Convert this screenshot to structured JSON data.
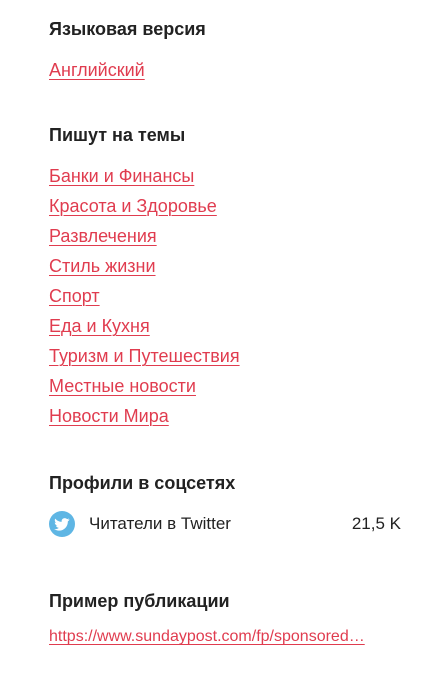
{
  "language_section": {
    "heading": "Языковая версия",
    "link": "Английский"
  },
  "topics_section": {
    "heading": "Пишут на темы",
    "items": [
      "Банки и Финансы",
      "Красота и Здоровье",
      "Развлечения",
      "Стиль жизни",
      "Спорт",
      "Еда и Кухня",
      "Туризм и Путешествия",
      "Местные новости",
      "Новости Мира"
    ]
  },
  "social_section": {
    "heading": "Профили в соцсетях",
    "twitter": {
      "icon": "twitter-icon",
      "label": "Читатели в Twitter",
      "count": "21,5 K"
    }
  },
  "sample_section": {
    "heading": "Пример публикации",
    "link": "https://www.sundaypost.com/fp/sponsored…"
  },
  "colors": {
    "link": "#e03c4f",
    "text": "#222222",
    "twitter": "#5fb6e4"
  }
}
